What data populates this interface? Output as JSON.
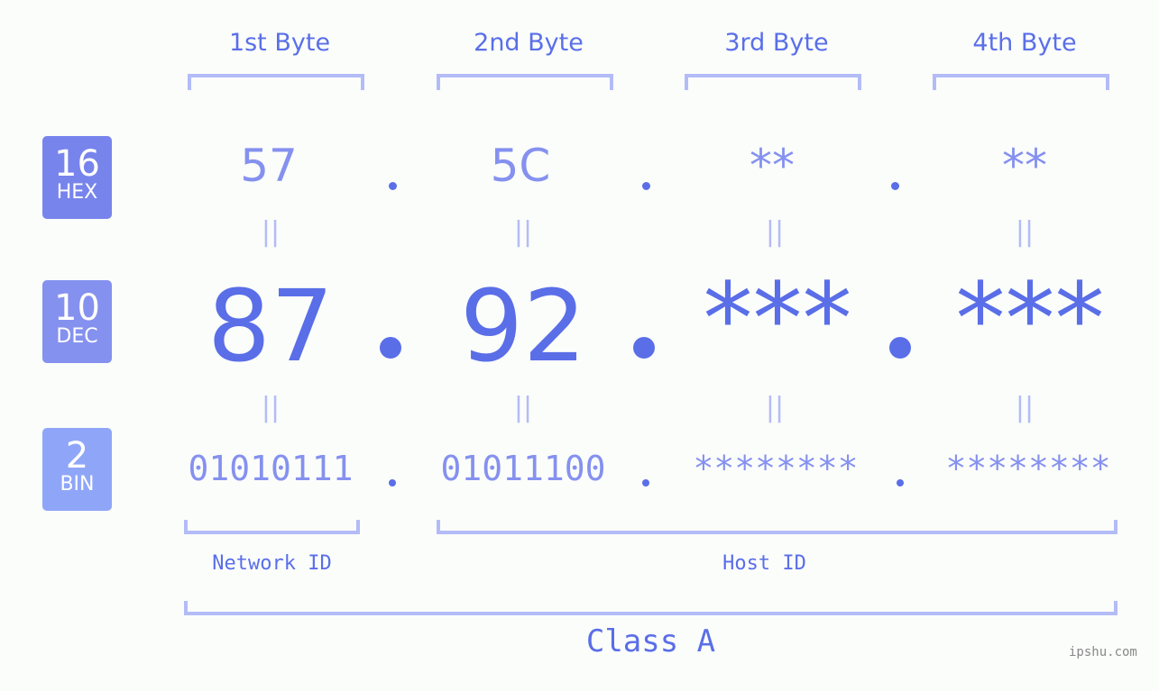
{
  "headers": [
    "1st Byte",
    "2nd Byte",
    "3rd Byte",
    "4th Byte"
  ],
  "bases": [
    {
      "number": "16",
      "label": "HEX",
      "color": "#7784ec"
    },
    {
      "number": "10",
      "label": "DEC",
      "color": "#8591ef"
    },
    {
      "number": "2",
      "label": "BIN",
      "color": "#8fa6f8"
    }
  ],
  "hex": [
    "57",
    "5C",
    "**",
    "**"
  ],
  "dec": [
    "87",
    "92",
    "***",
    "***"
  ],
  "bin": [
    "01010111",
    "01011100",
    "********",
    "********"
  ],
  "equals": "||",
  "network_label": "Network ID",
  "host_label": "Host ID",
  "class_label": "Class A",
  "watermark": "ipshu.com"
}
